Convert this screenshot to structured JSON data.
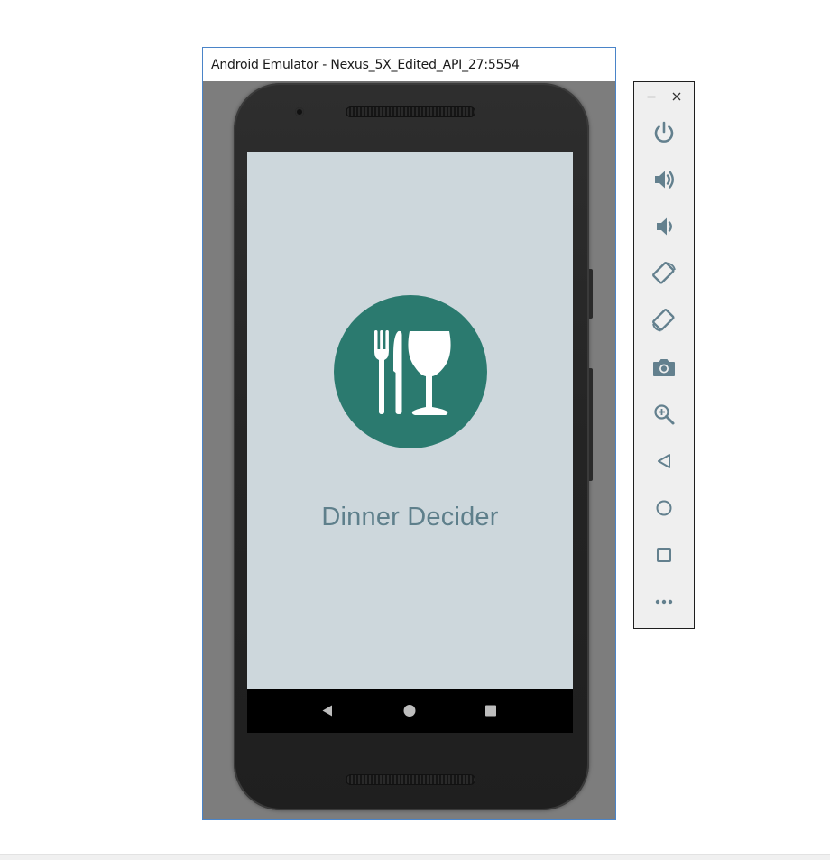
{
  "window": {
    "title": "Android Emulator - Nexus_5X_Edited_API_27:5554"
  },
  "app": {
    "title": "Dinner Decider",
    "logo_icon": "fork-knife-glass-icon",
    "logo_color": "#2b7a6f",
    "screen_background": "#cdd7dc",
    "title_color": "#5e7f8b"
  },
  "nav_bar": {
    "buttons": [
      "back",
      "home",
      "recents"
    ]
  },
  "toolbar": {
    "window_controls": [
      "minimize-icon",
      "close-icon"
    ],
    "icon_color": "#63808e",
    "buttons": [
      "power-icon",
      "volume-up-icon",
      "volume-down-icon",
      "rotate-left-icon",
      "rotate-right-icon",
      "camera-icon",
      "zoom-icon",
      "back-icon",
      "home-icon",
      "overview-icon",
      "more-icon"
    ]
  }
}
